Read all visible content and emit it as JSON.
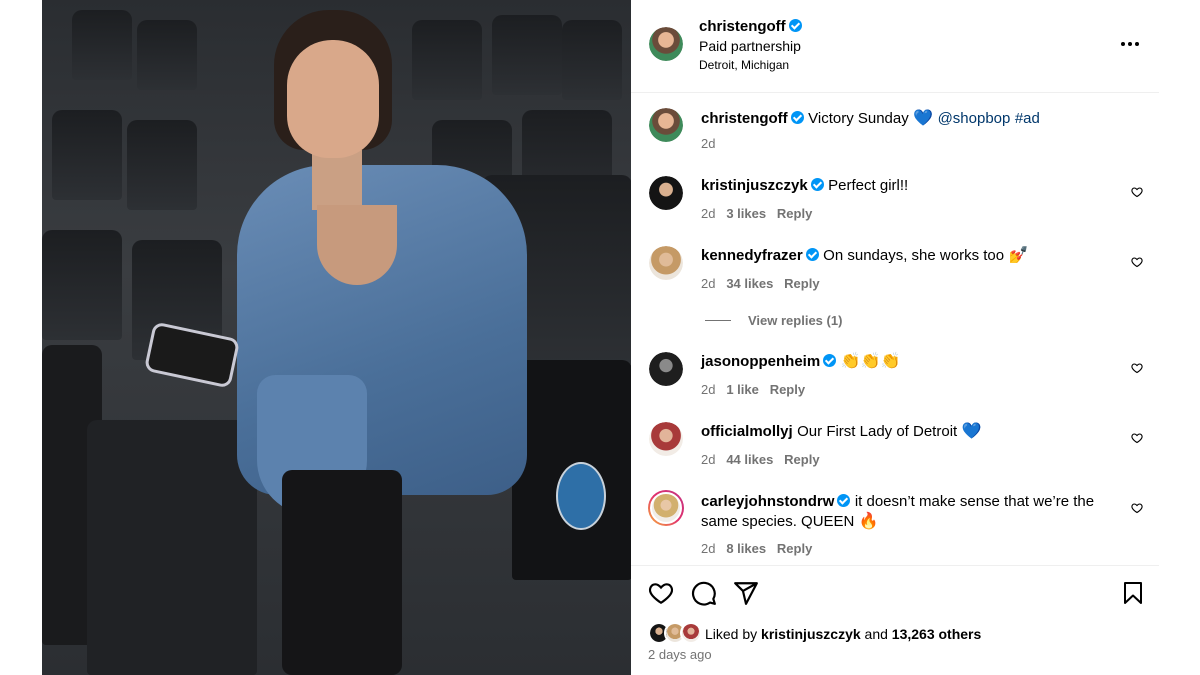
{
  "post": {
    "username": "christengoff",
    "partnership": "Paid partnership",
    "location": "Detroit, Michigan",
    "more_icon": "more-horizontal-icon"
  },
  "caption": {
    "username": "christengoff",
    "text": "Victory Sunday",
    "emoji": "💙",
    "mention": "@shopbop",
    "hashtag": "#ad",
    "time": "2d"
  },
  "comments": [
    {
      "username": "kristinjuszczyk",
      "text": "Perfect girl!!",
      "time": "2d",
      "likes": "3 likes",
      "reply": "Reply"
    },
    {
      "username": "kennedyfrazer",
      "text": "On sundays, she works too",
      "emoji": "💅",
      "time": "2d",
      "likes": "34 likes",
      "reply": "Reply",
      "view_replies": "View replies (1)"
    },
    {
      "username": "jasonoppenheim",
      "text": "",
      "emoji": "👏👏👏",
      "time": "2d",
      "likes": "1 like",
      "reply": "Reply"
    },
    {
      "username": "officialmollyj",
      "text": "Our First Lady of Detroit",
      "emoji": "💙",
      "time": "2d",
      "likes": "44 likes",
      "reply": "Reply"
    },
    {
      "username": "carleyjohnstondrw",
      "text": "it doesn’t make sense that we’re the same species. QUEEN",
      "emoji": "🔥",
      "time": "2d",
      "likes": "8 likes",
      "reply": "Reply"
    }
  ],
  "footer": {
    "liked_prefix": "Liked by",
    "liked_user": "kristinjuszczyk",
    "liked_and": "and",
    "liked_others": "13,263 others",
    "posted": "2 days ago"
  },
  "colors": {
    "verified": "#0095f6",
    "meta": "#737373",
    "link": "#00376b"
  }
}
